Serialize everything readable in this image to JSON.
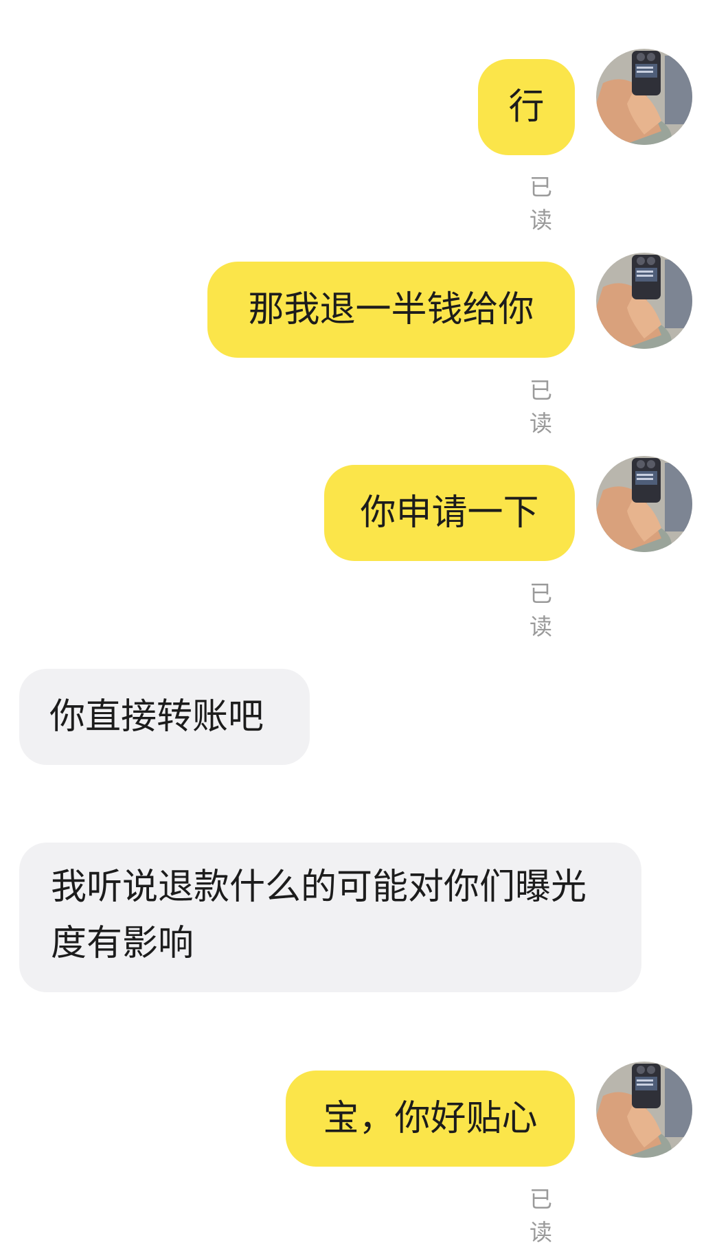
{
  "messages": [
    {
      "direction": "out",
      "text": "行",
      "status": "已读"
    },
    {
      "direction": "out",
      "text": "那我退一半钱给你",
      "status": "已读"
    },
    {
      "direction": "out",
      "text": "你申请一下",
      "status": "已读"
    },
    {
      "direction": "in",
      "text": "你直接转账吧"
    },
    {
      "direction": "in",
      "text": "我听说退款什么的可能对你们曝光度有影响"
    },
    {
      "direction": "out",
      "text": "宝，你好贴心",
      "status": "已读"
    }
  ],
  "avatar": {
    "icon": "user-avatar-photo"
  },
  "colors": {
    "outgoing_bubble": "#fbe54a",
    "incoming_bubble": "#f1f1f3",
    "read_status": "#9a9a9a"
  }
}
